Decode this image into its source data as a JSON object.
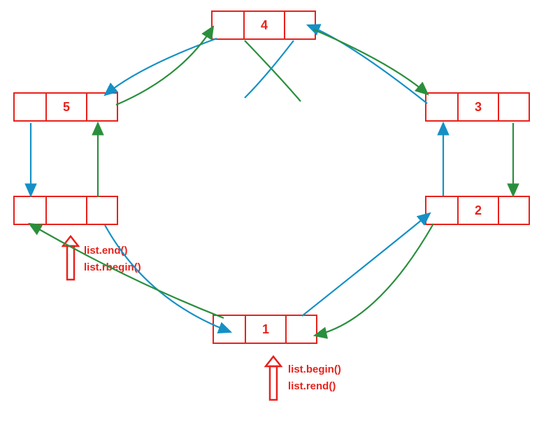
{
  "nodes": {
    "top": {
      "value": "4"
    },
    "ur": {
      "value": "3"
    },
    "mr": {
      "value": "2"
    },
    "bottom": {
      "value": "1"
    },
    "ml": {
      "value": ""
    },
    "ul": {
      "value": "5"
    }
  },
  "labels": {
    "end": "list.end()",
    "rbegin": "list.rbegin()",
    "begin": "list.begin()",
    "rend": "list.rend()"
  },
  "colors": {
    "box": "#e8211b",
    "next": "#1590c5",
    "prev": "#2a8f3d"
  }
}
